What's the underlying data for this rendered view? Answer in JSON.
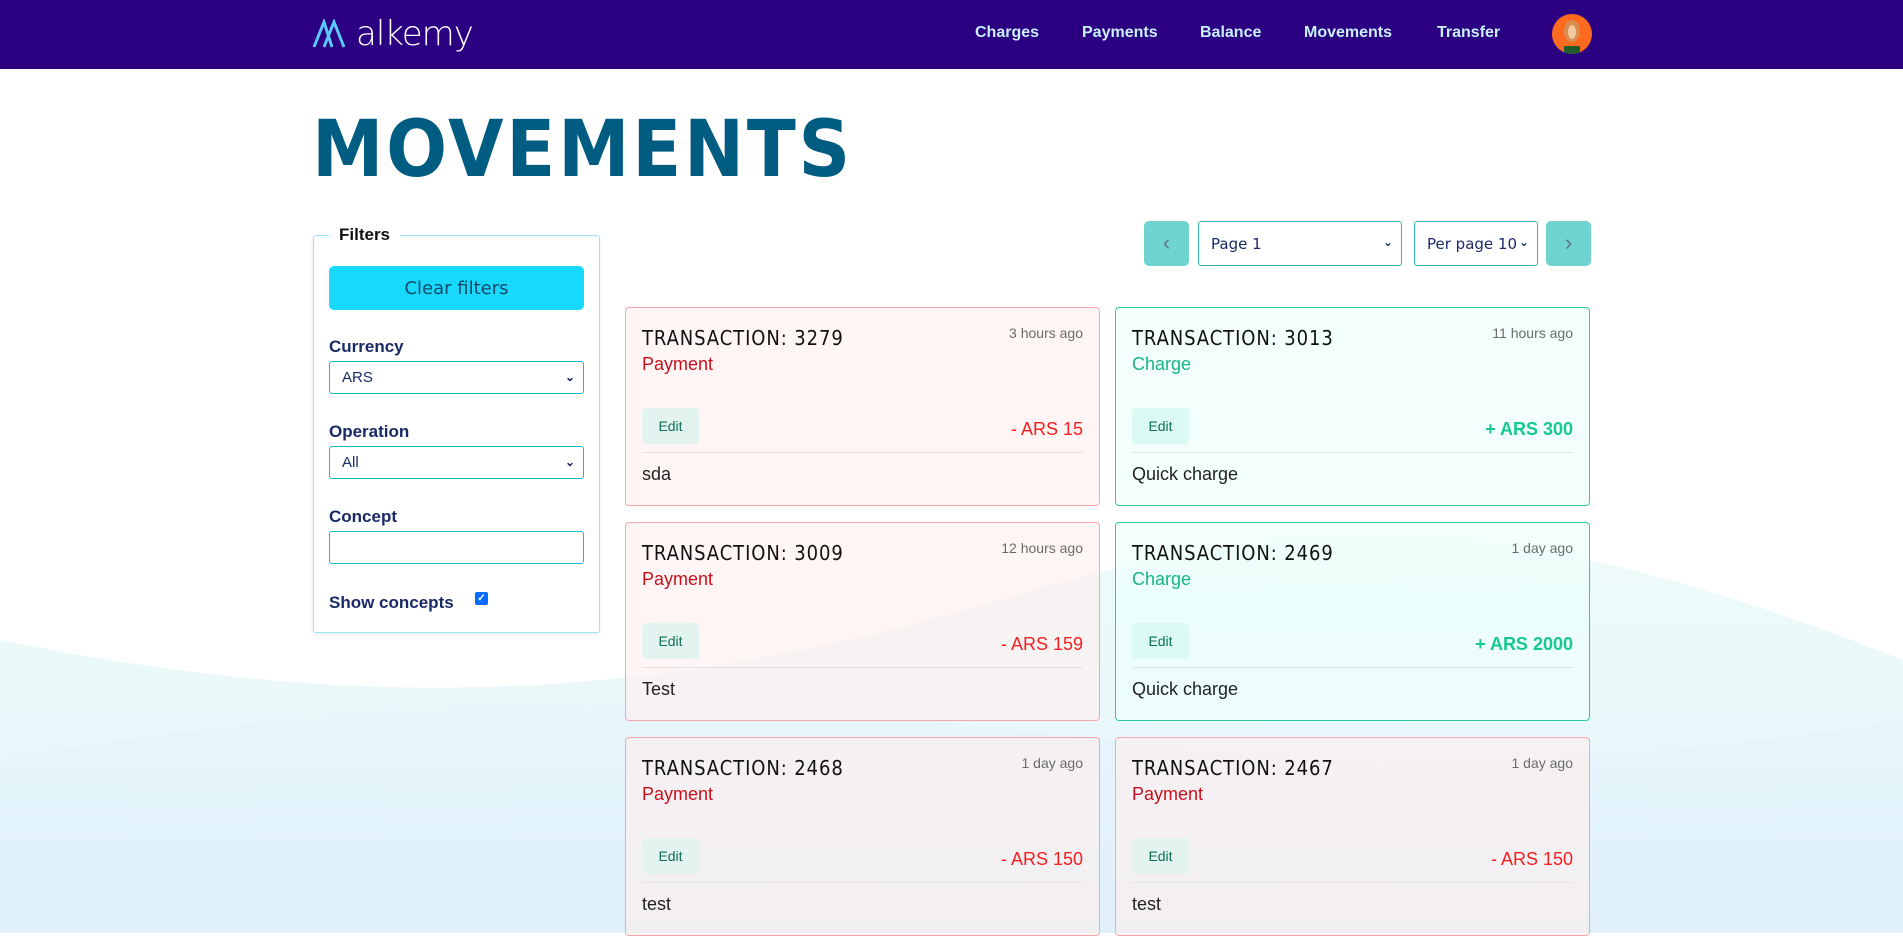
{
  "nav": {
    "logo": "alkemy",
    "links": [
      "Charges",
      "Payments",
      "Balance",
      "Movements",
      "Transfer"
    ]
  },
  "page": {
    "title": "MOVEMENTS"
  },
  "filters": {
    "legend": "Filters",
    "clear_label": "Clear filters",
    "currency_label": "Currency",
    "currency_value": "ARS",
    "operation_label": "Operation",
    "operation_value": "All",
    "concept_label": "Concept",
    "concept_value": "",
    "show_concepts_label": "Show concepts",
    "show_concepts_checked": true
  },
  "pagination": {
    "page_value": "Page 1",
    "per_page_value": "Per page 10"
  },
  "colors": {
    "nav": "#2b0081",
    "title": "#005c80",
    "payment": "#c8101c",
    "charge": "#17b585",
    "clear_button": "#18d8fc"
  },
  "transactions": [
    {
      "title": "TRANSACTION: 3279",
      "type": "Payment",
      "time": "3 hours ago",
      "amount": "- ARS 15",
      "concept": "sda",
      "edit": "Edit"
    },
    {
      "title": "TRANSACTION: 3013",
      "type": "Charge",
      "time": "11 hours ago",
      "amount": "+ ARS 300",
      "concept": "Quick charge",
      "edit": "Edit"
    },
    {
      "title": "TRANSACTION: 3009",
      "type": "Payment",
      "time": "12 hours ago",
      "amount": "- ARS 159",
      "concept": "Test",
      "edit": "Edit"
    },
    {
      "title": "TRANSACTION: 2469",
      "type": "Charge",
      "time": "1 day ago",
      "amount": "+ ARS 2000",
      "concept": "Quick charge",
      "edit": "Edit"
    },
    {
      "title": "TRANSACTION: 2468",
      "type": "Payment",
      "time": "1 day ago",
      "amount": "- ARS 150",
      "concept": "test",
      "edit": "Edit"
    },
    {
      "title": "TRANSACTION: 2467",
      "type": "Payment",
      "time": "1 day ago",
      "amount": "- ARS 150",
      "concept": "test",
      "edit": "Edit"
    }
  ]
}
